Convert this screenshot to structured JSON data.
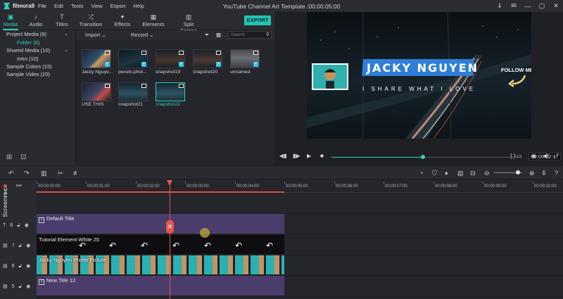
{
  "app": {
    "logo_text": "filmora9",
    "window_title": "YouTube Channel Art Template :00:00:05:00",
    "menu": [
      "File",
      "Edit",
      "Tools",
      "View",
      "Export",
      "Help"
    ]
  },
  "window_buttons": [
    "⇓",
    "✉",
    "—",
    "▢",
    "✕"
  ],
  "toolbar": {
    "tabs": [
      {
        "label": "Media",
        "icon": "media-folder-icon",
        "glyph": "▣"
      },
      {
        "label": "Audio",
        "icon": "music-note-icon",
        "glyph": "♪"
      },
      {
        "label": "Titles",
        "icon": "text-t-icon",
        "glyph": "T"
      },
      {
        "label": "Transition",
        "icon": "transition-icon",
        "glyph": "⤮"
      },
      {
        "label": "Effects",
        "icon": "effects-icon",
        "glyph": "✦"
      },
      {
        "label": "Elements",
        "icon": "elements-icon",
        "glyph": "▦"
      },
      {
        "label": "Split Screen",
        "icon": "split-screen-icon",
        "glyph": "▥"
      }
    ],
    "export_label": "EXPORT"
  },
  "media_tree": {
    "items": [
      {
        "label": "Project Media (8)",
        "chevron": "⌄"
      },
      {
        "label": "Folder (8)",
        "selected": true
      },
      {
        "label": "Shared Media (10)",
        "chevron": "⌄"
      },
      {
        "label": "Intro (10)"
      },
      {
        "label": "Sample Colors (15)",
        "chevron": ""
      },
      {
        "label": "Sample Video (20)",
        "chevron": ""
      }
    ]
  },
  "media_toolbar": {
    "import_label": "Import",
    "record_label": "Record",
    "search_placeholder": "Search"
  },
  "media_items": [
    {
      "label": "Jacky Nguye...",
      "checked": true
    },
    {
      "label": "pexels-phot...",
      "checked": true
    },
    {
      "label": "snapshot19",
      "checked": true
    },
    {
      "label": "snapshot20",
      "checked": true
    },
    {
      "label": "unnamed",
      "checked": true
    },
    {
      "label": "USE THIS",
      "checked": false
    },
    {
      "label": "snapshot21",
      "checked": false
    },
    {
      "label": "snapshot22",
      "checked": false,
      "selected": true
    }
  ],
  "preview": {
    "name_text": "JACKY NGUYEN",
    "tagline_text": "I SHARE WHAT I LOVE",
    "follow_text": "FOLLOW ME",
    "current_time": "00:00:02:17",
    "progress": 0.48,
    "brace_text": "{ }"
  },
  "timeline": {
    "ruler_ticks": [
      "00:00:00:00",
      "00:00:01:00",
      "00:00:02:00",
      "00:00:03:00",
      "00:00:04:00",
      "00:00:05:00",
      "00:00:06:00",
      "00:00:07:00",
      "00:00:08:00",
      "00:00:09:00",
      "00:00:10:00"
    ],
    "watermark": {
      "prefix": "Screen",
      "suffix": "rec"
    },
    "tracks": [
      {
        "number": "8",
        "clip": "Default Title",
        "type": "title"
      },
      {
        "number": "7",
        "clip": "Tutorial Element White 25",
        "type": "element"
      },
      {
        "number": "6",
        "clip": "Jacky Nguyen Profile Picture",
        "type": "video"
      },
      {
        "number": "5",
        "clip": "New Title 12",
        "type": "title"
      }
    ]
  },
  "colors": {
    "accent": "#2fd0c0",
    "export_button": "#22c5b3",
    "playhead": "#e8584a",
    "title_clip": "#4b3d6b",
    "name_banner": "#2f7fd8"
  }
}
